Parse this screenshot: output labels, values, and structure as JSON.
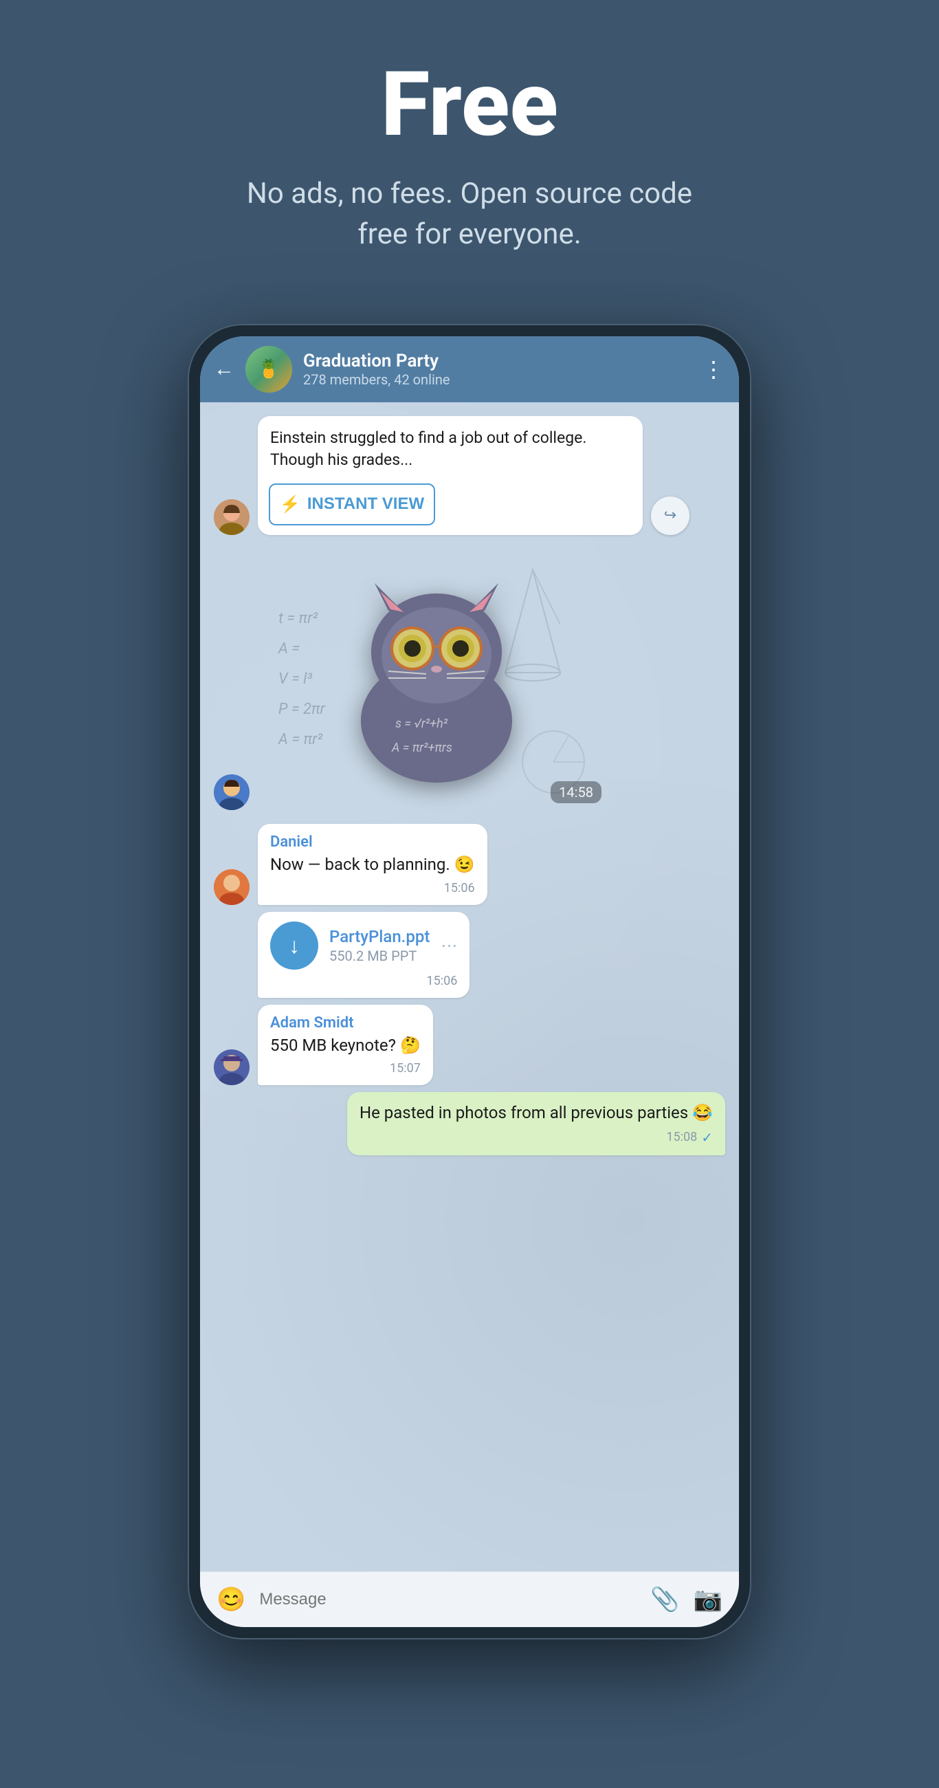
{
  "hero": {
    "title": "Free",
    "subtitle": "No ads, no fees. Open source code free for everyone."
  },
  "chat": {
    "header": {
      "back_label": "←",
      "group_name": "Graduation Party",
      "group_status": "278 members, 42 online",
      "more_label": "⋮",
      "group_emoji": "🍍"
    },
    "messages": [
      {
        "id": "article-msg",
        "type": "article",
        "snippet": "Einstein struggled to find a job out of college. Though his grades...",
        "instant_view_label": "INSTANT VIEW",
        "time": ""
      },
      {
        "id": "sticker-msg",
        "type": "sticker",
        "time": "14:58"
      },
      {
        "id": "daniel-msg",
        "type": "text",
        "sender": "Daniel",
        "text": "Now — back to planning. 😉",
        "time": "15:06"
      },
      {
        "id": "file-msg",
        "type": "file",
        "file_name": "PartyPlan.ppt",
        "file_size": "550.2 MB PPT",
        "time": "15:06"
      },
      {
        "id": "adam-msg",
        "type": "text",
        "sender": "Adam Smidt",
        "text": "550 MB keynote? 🤔",
        "time": "15:07"
      },
      {
        "id": "outgoing-msg",
        "type": "outgoing",
        "text": "He pasted in photos from all previous parties 😂",
        "time": "15:08"
      }
    ]
  },
  "input_bar": {
    "placeholder": "Message",
    "emoji_icon": "😊",
    "attach_icon": "📎",
    "camera_icon": "📷"
  }
}
